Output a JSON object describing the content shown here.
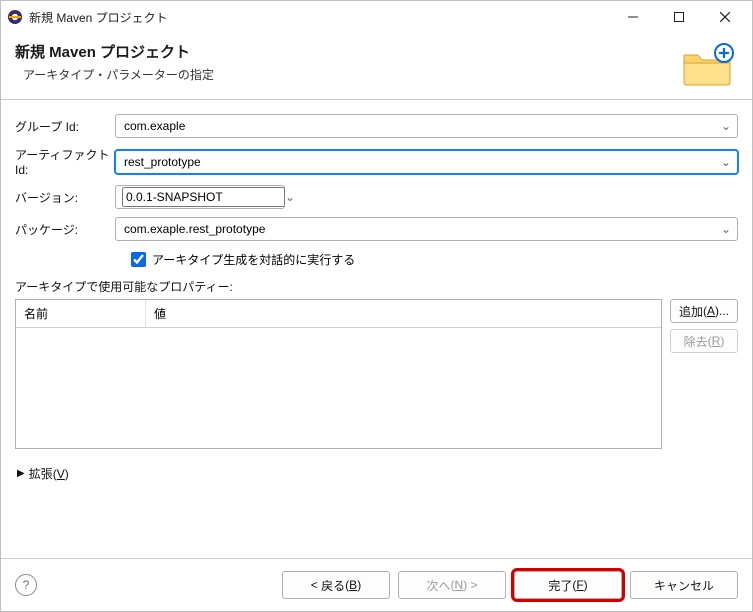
{
  "window": {
    "title": "新規 Maven プロジェクト"
  },
  "header": {
    "title": "新規 Maven プロジェクト",
    "subtitle": "アーキタイプ・パラメーターの指定"
  },
  "form": {
    "groupId": {
      "label": "グループ Id:",
      "value": "com.exaple"
    },
    "artifactId": {
      "label": "アーティファクト Id:",
      "value": "rest_prototype"
    },
    "version": {
      "label": "バージョン:",
      "value": "0.0.1-SNAPSHOT"
    },
    "pkg": {
      "label": "パッケージ:",
      "value": "com.exaple.rest_prototype"
    },
    "interactiveCheckbox": "アーキタイプ生成を対話的に実行する"
  },
  "properties": {
    "caption": "アーキタイプで使用可能なプロパティー:",
    "columns": [
      "名前",
      "値"
    ],
    "addBtn": {
      "main": "追加",
      "mn": "A",
      "tail": "..."
    },
    "removeBtn": {
      "main": "除去",
      "mn": "R"
    }
  },
  "advanced": {
    "main": "拡張",
    "mn": "V"
  },
  "buttons": {
    "back": {
      "pre": "<",
      "main": "戻る",
      "mn": "B"
    },
    "next": {
      "main": "次へ",
      "mn": "N",
      "post": ">"
    },
    "finish": {
      "main": "完了",
      "mn": "F"
    },
    "cancel": "キャンセル"
  }
}
